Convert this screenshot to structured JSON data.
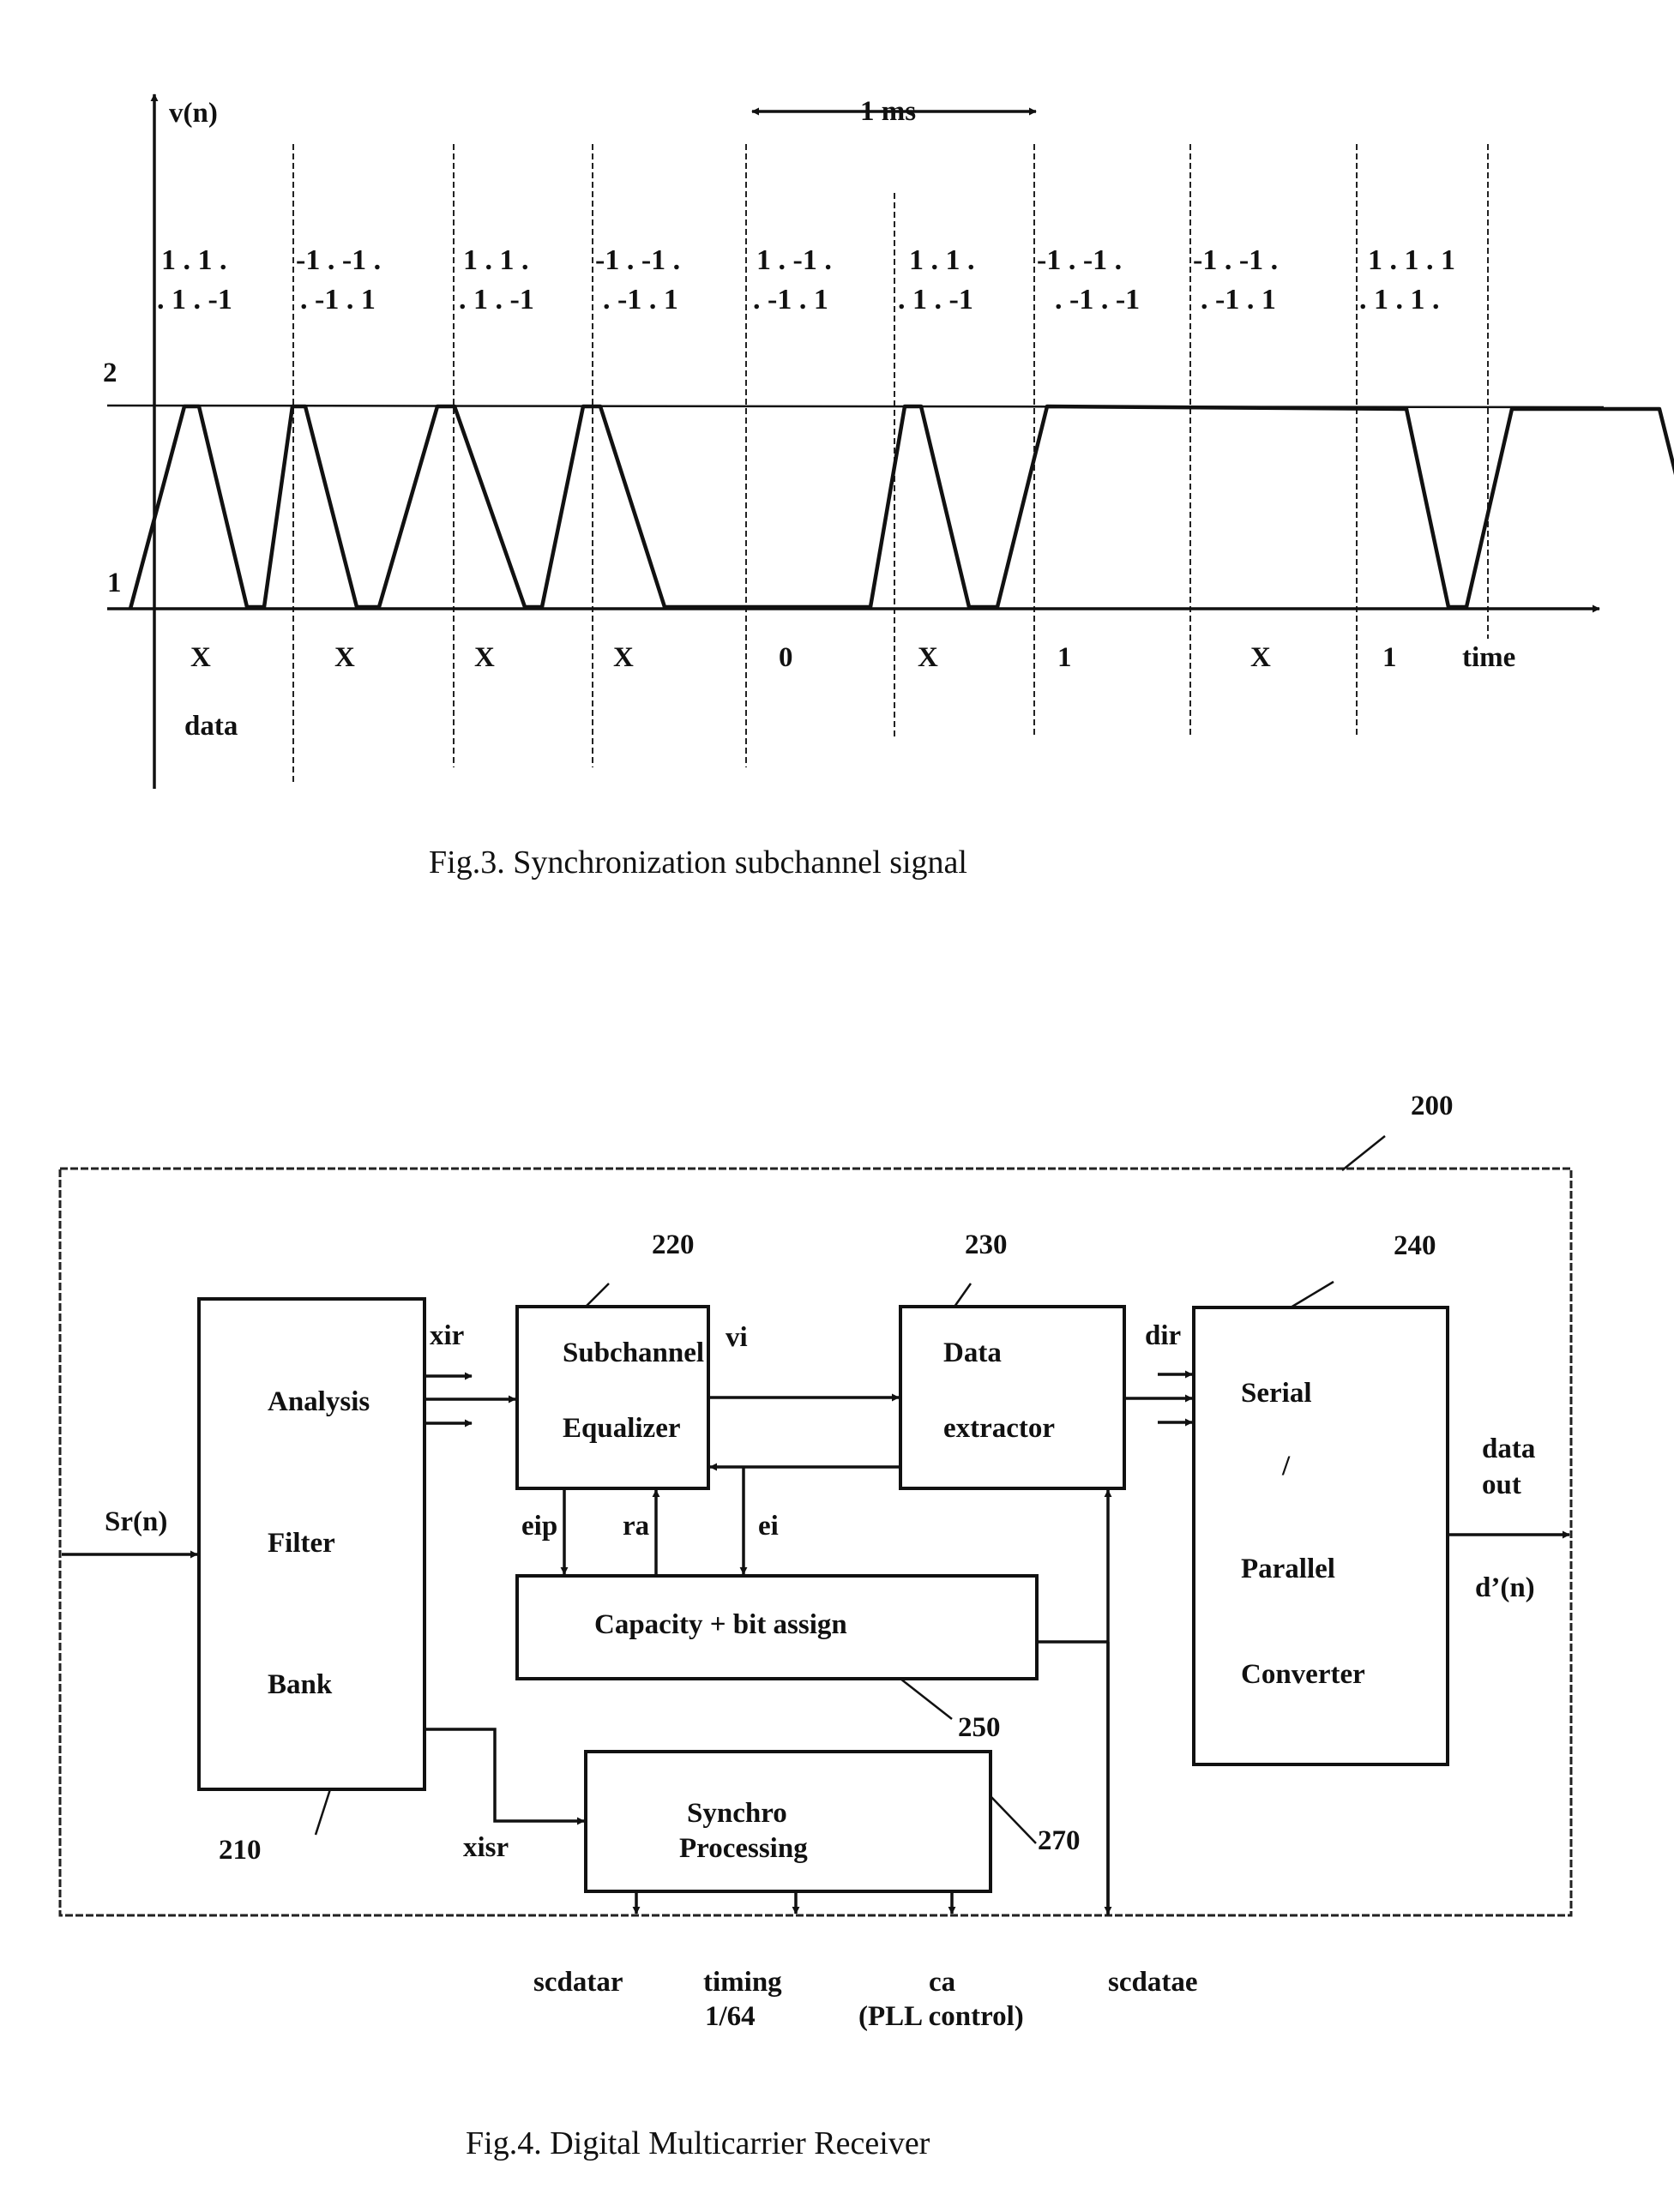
{
  "fig3": {
    "caption": "Fig.3.  Synchronization subchannel  signal",
    "y_axis_label": "v(n)",
    "x_axis_label": "time",
    "level_high": "2",
    "level_low": "1",
    "period_label": "1 ms",
    "row_label": "data",
    "sequence_row1": [
      "1 . 1 .",
      "-1 . -1 .",
      "1 . 1 .",
      "-1 . -1 .",
      "1 . -1 .",
      "1 . 1 .",
      "-1 . -1 .",
      "-1 . -1 .",
      "1 . 1 . 1"
    ],
    "sequence_row2": [
      ". 1 . -1",
      ". -1 . 1",
      ". 1 . -1",
      ". -1 . 1",
      ". -1 . 1",
      ". 1 . -1",
      ". -1 . -1",
      ". -1 . 1",
      ". 1 . 1 ."
    ],
    "data_symbols": [
      "X",
      "X",
      "X",
      "X",
      "0",
      "X",
      "1",
      "X",
      "1"
    ]
  },
  "fig4": {
    "caption": "Fig.4.  Digital Multicarrier Receiver",
    "ref_outer": "200",
    "blocks": {
      "analysis": {
        "ref": "210",
        "lines": [
          "Analysis",
          "Filter",
          "Bank"
        ]
      },
      "equalizer": {
        "ref": "220",
        "lines": [
          "Subchannel",
          "Equalizer"
        ]
      },
      "extractor": {
        "ref": "230",
        "lines": [
          "Data",
          "extractor"
        ]
      },
      "converter": {
        "ref": "240",
        "lines": [
          "Serial",
          "/",
          "Parallel",
          "Converter"
        ]
      },
      "capacity": {
        "ref": "250",
        "lines": [
          "Capacity + bit assign"
        ]
      },
      "synchro": {
        "ref": "270",
        "lines": [
          "Synchro",
          "Processing"
        ]
      }
    },
    "signals": {
      "input": "Sr(n)",
      "xir": "xir",
      "vi": "vi",
      "dir": "dir",
      "eip": "eip",
      "ra": "ra",
      "ei": "ei",
      "xisr": "xisr",
      "data_out_1": "data",
      "data_out_2": "out",
      "output": "d’(n)"
    },
    "outputs": {
      "scdatar": "scdatar",
      "timing_1": "timing",
      "timing_2": "1/64",
      "ca_1": "ca",
      "ca_2": "(PLL control)",
      "scdatae": "scdatae"
    }
  }
}
